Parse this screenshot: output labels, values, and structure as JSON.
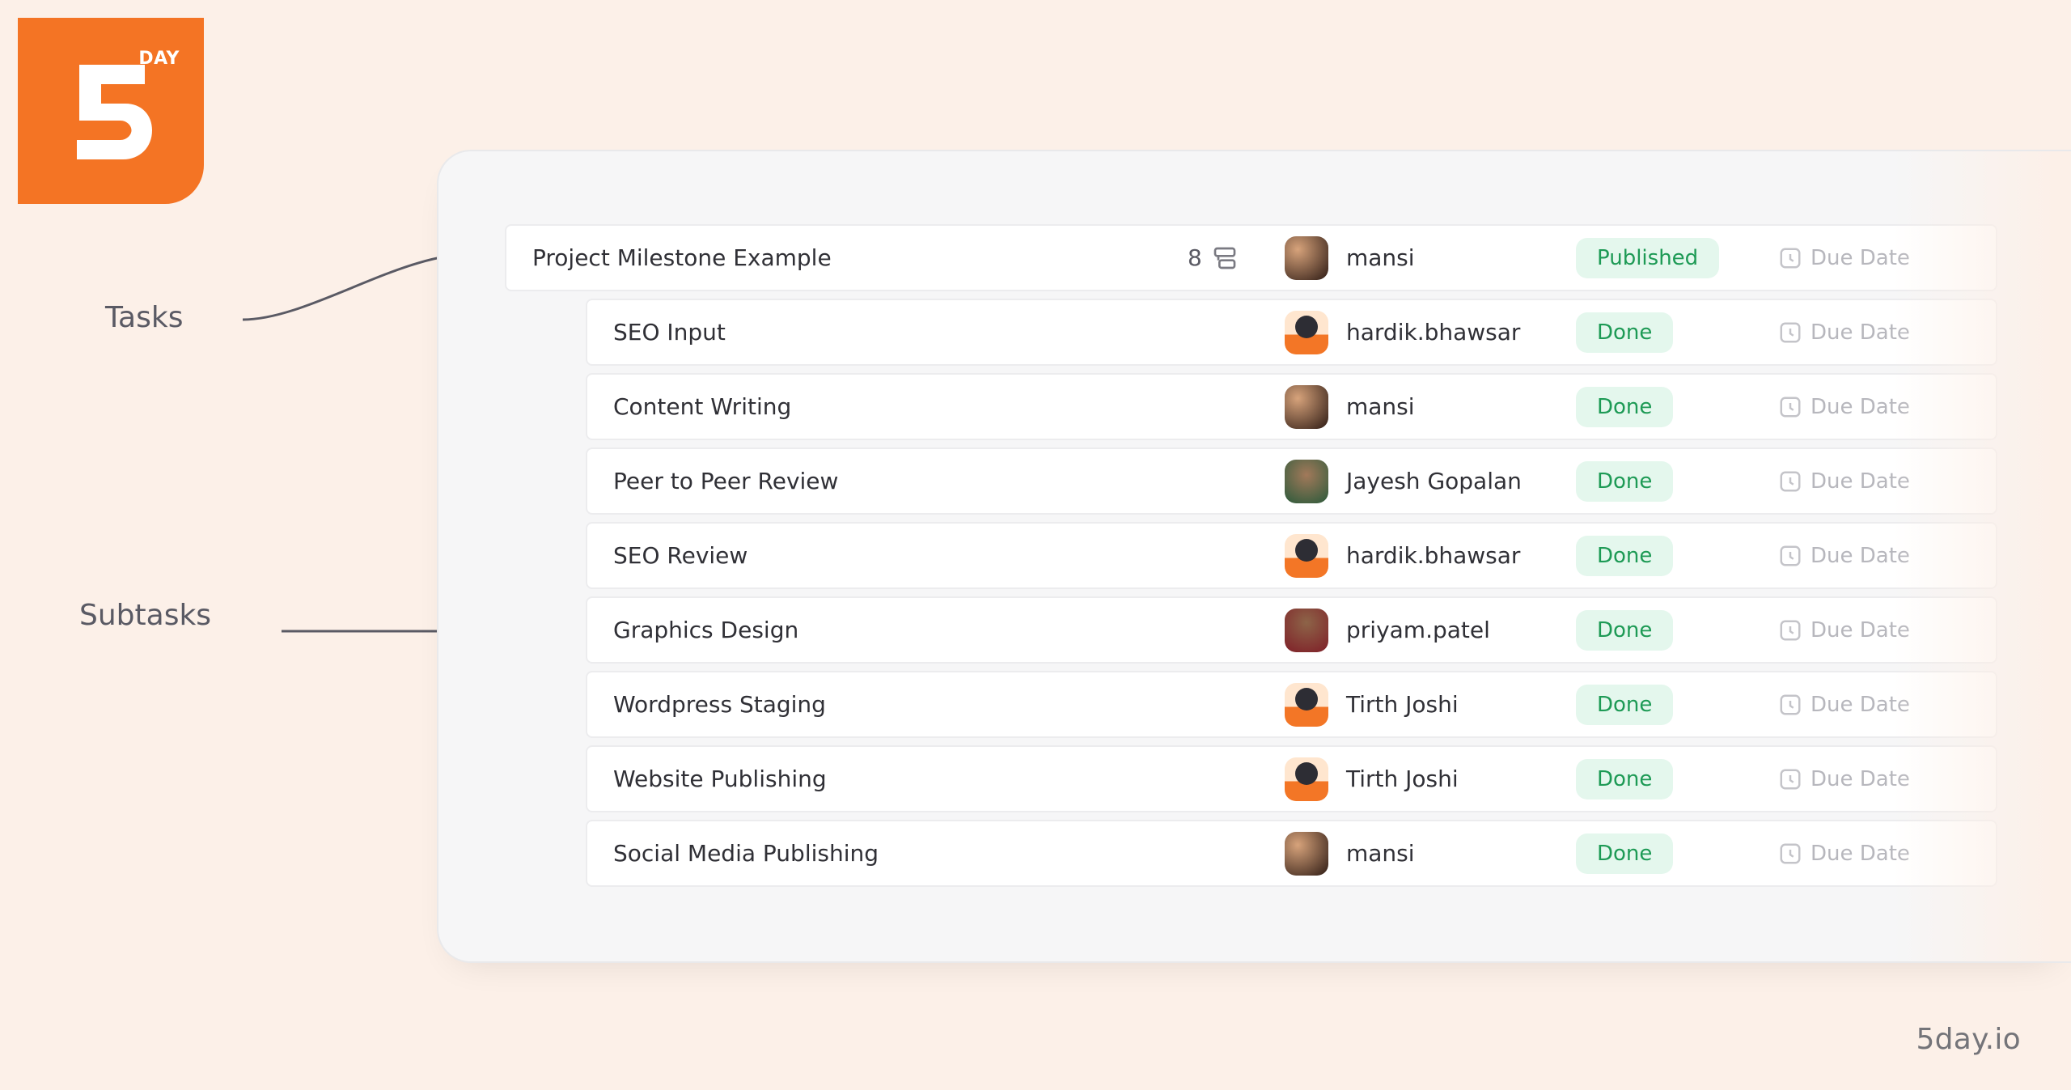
{
  "brand": {
    "footer": "5day.io",
    "logo_day": "DAY"
  },
  "annotations": {
    "tasks_label": "Tasks",
    "subtasks_label": "Subtasks"
  },
  "task": {
    "name": "Project Milestone Example",
    "subtask_count": "8",
    "assignee": "mansi",
    "avatar_key": "mansi",
    "status": "Published",
    "due_label": "Due Date"
  },
  "subtasks": [
    {
      "name": "SEO Input",
      "assignee": "hardik.bhawsar",
      "avatar_key": "hardik",
      "status": "Done",
      "due_label": "Due Date"
    },
    {
      "name": "Content Writing",
      "assignee": "mansi",
      "avatar_key": "mansi",
      "status": "Done",
      "due_label": "Due Date"
    },
    {
      "name": "Peer to Peer Review",
      "assignee": "Jayesh Gopalan",
      "avatar_key": "jayesh",
      "status": "Done",
      "due_label": "Due Date"
    },
    {
      "name": "SEO Review",
      "assignee": "hardik.bhawsar",
      "avatar_key": "hardik",
      "status": "Done",
      "due_label": "Due Date"
    },
    {
      "name": "Graphics Design",
      "assignee": "priyam.patel",
      "avatar_key": "priyam",
      "status": "Done",
      "due_label": "Due Date"
    },
    {
      "name": "Wordpress Staging",
      "assignee": "Tirth Joshi",
      "avatar_key": "tirth",
      "status": "Done",
      "due_label": "Due Date"
    },
    {
      "name": "Website Publishing",
      "assignee": "Tirth Joshi",
      "avatar_key": "tirth",
      "status": "Done",
      "due_label": "Due Date"
    },
    {
      "name": "Social Media Publishing",
      "assignee": "mansi",
      "avatar_key": "mansi",
      "status": "Done",
      "due_label": "Due Date"
    }
  ]
}
